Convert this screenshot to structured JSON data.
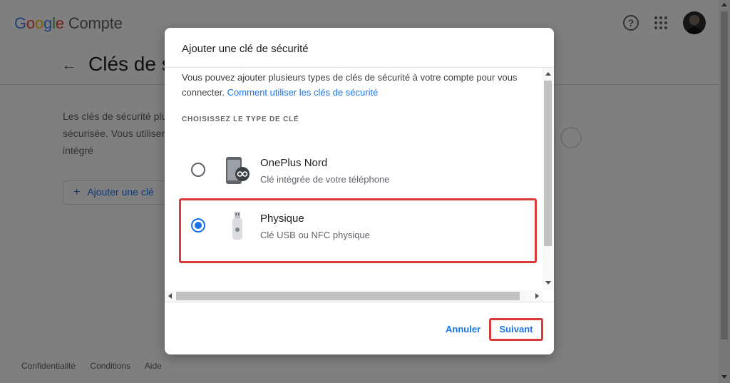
{
  "header": {
    "logo_letters": [
      "G",
      "o",
      "o",
      "g",
      "l",
      "e"
    ],
    "product": "Compte",
    "help_glyph": "?",
    "icons": [
      "help-circle-icon",
      "apps-grid-icon",
      "avatar"
    ]
  },
  "page": {
    "back_glyph": "←",
    "title": "Clés de s",
    "description": "Les clés de sécurité plus sécurisée. Vous utiliser la clé intégré",
    "add_button_plus": "+",
    "add_button_label": "Ajouter une clé",
    "footer_links": [
      "Confidentialité",
      "Conditions",
      "Aide"
    ]
  },
  "dialog": {
    "title": "Ajouter une clé de sécurité",
    "intro_text": "Vous pouvez ajouter plusieurs types de clés de sécurité à votre compte pour vous connecter.",
    "intro_link": "Comment utiliser les clés de sécurité",
    "section_label": "CHOISISSEZ LE TYPE DE CLÉ",
    "options": [
      {
        "name": "OnePlus Nord",
        "subtitle": "Clé intégrée de votre téléphone",
        "selected": false,
        "icon": "phone-key-icon"
      },
      {
        "name": "Physique",
        "subtitle": "Clé USB ou NFC physique",
        "selected": true,
        "icon": "usb-key-icon"
      }
    ],
    "cancel_label": "Annuler",
    "next_label": "Suivant"
  },
  "colors": {
    "accent": "#1a73e8",
    "highlight": "#d93a3a",
    "text_primary": "#202124",
    "text_secondary": "#5f6368"
  }
}
